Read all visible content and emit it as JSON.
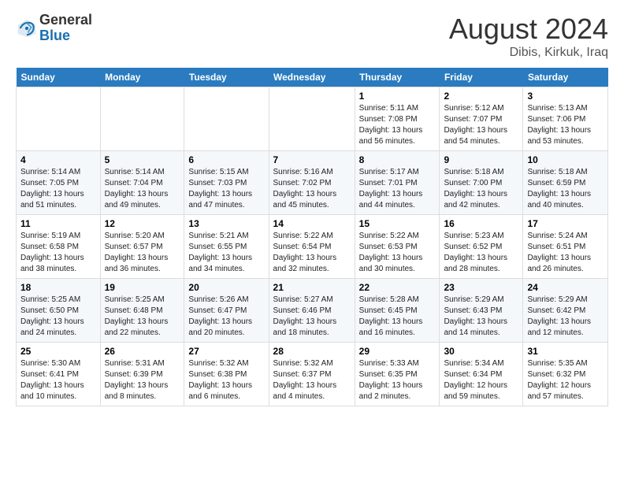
{
  "header": {
    "logo_general": "General",
    "logo_blue": "Blue",
    "month_year": "August 2024",
    "location": "Dibis, Kirkuk, Iraq"
  },
  "weekdays": [
    "Sunday",
    "Monday",
    "Tuesday",
    "Wednesday",
    "Thursday",
    "Friday",
    "Saturday"
  ],
  "weeks": [
    [
      {
        "day": "",
        "info": ""
      },
      {
        "day": "",
        "info": ""
      },
      {
        "day": "",
        "info": ""
      },
      {
        "day": "",
        "info": ""
      },
      {
        "day": "1",
        "info": "Sunrise: 5:11 AM\nSunset: 7:08 PM\nDaylight: 13 hours\nand 56 minutes."
      },
      {
        "day": "2",
        "info": "Sunrise: 5:12 AM\nSunset: 7:07 PM\nDaylight: 13 hours\nand 54 minutes."
      },
      {
        "day": "3",
        "info": "Sunrise: 5:13 AM\nSunset: 7:06 PM\nDaylight: 13 hours\nand 53 minutes."
      }
    ],
    [
      {
        "day": "4",
        "info": "Sunrise: 5:14 AM\nSunset: 7:05 PM\nDaylight: 13 hours\nand 51 minutes."
      },
      {
        "day": "5",
        "info": "Sunrise: 5:14 AM\nSunset: 7:04 PM\nDaylight: 13 hours\nand 49 minutes."
      },
      {
        "day": "6",
        "info": "Sunrise: 5:15 AM\nSunset: 7:03 PM\nDaylight: 13 hours\nand 47 minutes."
      },
      {
        "day": "7",
        "info": "Sunrise: 5:16 AM\nSunset: 7:02 PM\nDaylight: 13 hours\nand 45 minutes."
      },
      {
        "day": "8",
        "info": "Sunrise: 5:17 AM\nSunset: 7:01 PM\nDaylight: 13 hours\nand 44 minutes."
      },
      {
        "day": "9",
        "info": "Sunrise: 5:18 AM\nSunset: 7:00 PM\nDaylight: 13 hours\nand 42 minutes."
      },
      {
        "day": "10",
        "info": "Sunrise: 5:18 AM\nSunset: 6:59 PM\nDaylight: 13 hours\nand 40 minutes."
      }
    ],
    [
      {
        "day": "11",
        "info": "Sunrise: 5:19 AM\nSunset: 6:58 PM\nDaylight: 13 hours\nand 38 minutes."
      },
      {
        "day": "12",
        "info": "Sunrise: 5:20 AM\nSunset: 6:57 PM\nDaylight: 13 hours\nand 36 minutes."
      },
      {
        "day": "13",
        "info": "Sunrise: 5:21 AM\nSunset: 6:55 PM\nDaylight: 13 hours\nand 34 minutes."
      },
      {
        "day": "14",
        "info": "Sunrise: 5:22 AM\nSunset: 6:54 PM\nDaylight: 13 hours\nand 32 minutes."
      },
      {
        "day": "15",
        "info": "Sunrise: 5:22 AM\nSunset: 6:53 PM\nDaylight: 13 hours\nand 30 minutes."
      },
      {
        "day": "16",
        "info": "Sunrise: 5:23 AM\nSunset: 6:52 PM\nDaylight: 13 hours\nand 28 minutes."
      },
      {
        "day": "17",
        "info": "Sunrise: 5:24 AM\nSunset: 6:51 PM\nDaylight: 13 hours\nand 26 minutes."
      }
    ],
    [
      {
        "day": "18",
        "info": "Sunrise: 5:25 AM\nSunset: 6:50 PM\nDaylight: 13 hours\nand 24 minutes."
      },
      {
        "day": "19",
        "info": "Sunrise: 5:25 AM\nSunset: 6:48 PM\nDaylight: 13 hours\nand 22 minutes."
      },
      {
        "day": "20",
        "info": "Sunrise: 5:26 AM\nSunset: 6:47 PM\nDaylight: 13 hours\nand 20 minutes."
      },
      {
        "day": "21",
        "info": "Sunrise: 5:27 AM\nSunset: 6:46 PM\nDaylight: 13 hours\nand 18 minutes."
      },
      {
        "day": "22",
        "info": "Sunrise: 5:28 AM\nSunset: 6:45 PM\nDaylight: 13 hours\nand 16 minutes."
      },
      {
        "day": "23",
        "info": "Sunrise: 5:29 AM\nSunset: 6:43 PM\nDaylight: 13 hours\nand 14 minutes."
      },
      {
        "day": "24",
        "info": "Sunrise: 5:29 AM\nSunset: 6:42 PM\nDaylight: 13 hours\nand 12 minutes."
      }
    ],
    [
      {
        "day": "25",
        "info": "Sunrise: 5:30 AM\nSunset: 6:41 PM\nDaylight: 13 hours\nand 10 minutes."
      },
      {
        "day": "26",
        "info": "Sunrise: 5:31 AM\nSunset: 6:39 PM\nDaylight: 13 hours\nand 8 minutes."
      },
      {
        "day": "27",
        "info": "Sunrise: 5:32 AM\nSunset: 6:38 PM\nDaylight: 13 hours\nand 6 minutes."
      },
      {
        "day": "28",
        "info": "Sunrise: 5:32 AM\nSunset: 6:37 PM\nDaylight: 13 hours\nand 4 minutes."
      },
      {
        "day": "29",
        "info": "Sunrise: 5:33 AM\nSunset: 6:35 PM\nDaylight: 13 hours\nand 2 minutes."
      },
      {
        "day": "30",
        "info": "Sunrise: 5:34 AM\nSunset: 6:34 PM\nDaylight: 12 hours\nand 59 minutes."
      },
      {
        "day": "31",
        "info": "Sunrise: 5:35 AM\nSunset: 6:32 PM\nDaylight: 12 hours\nand 57 minutes."
      }
    ]
  ]
}
